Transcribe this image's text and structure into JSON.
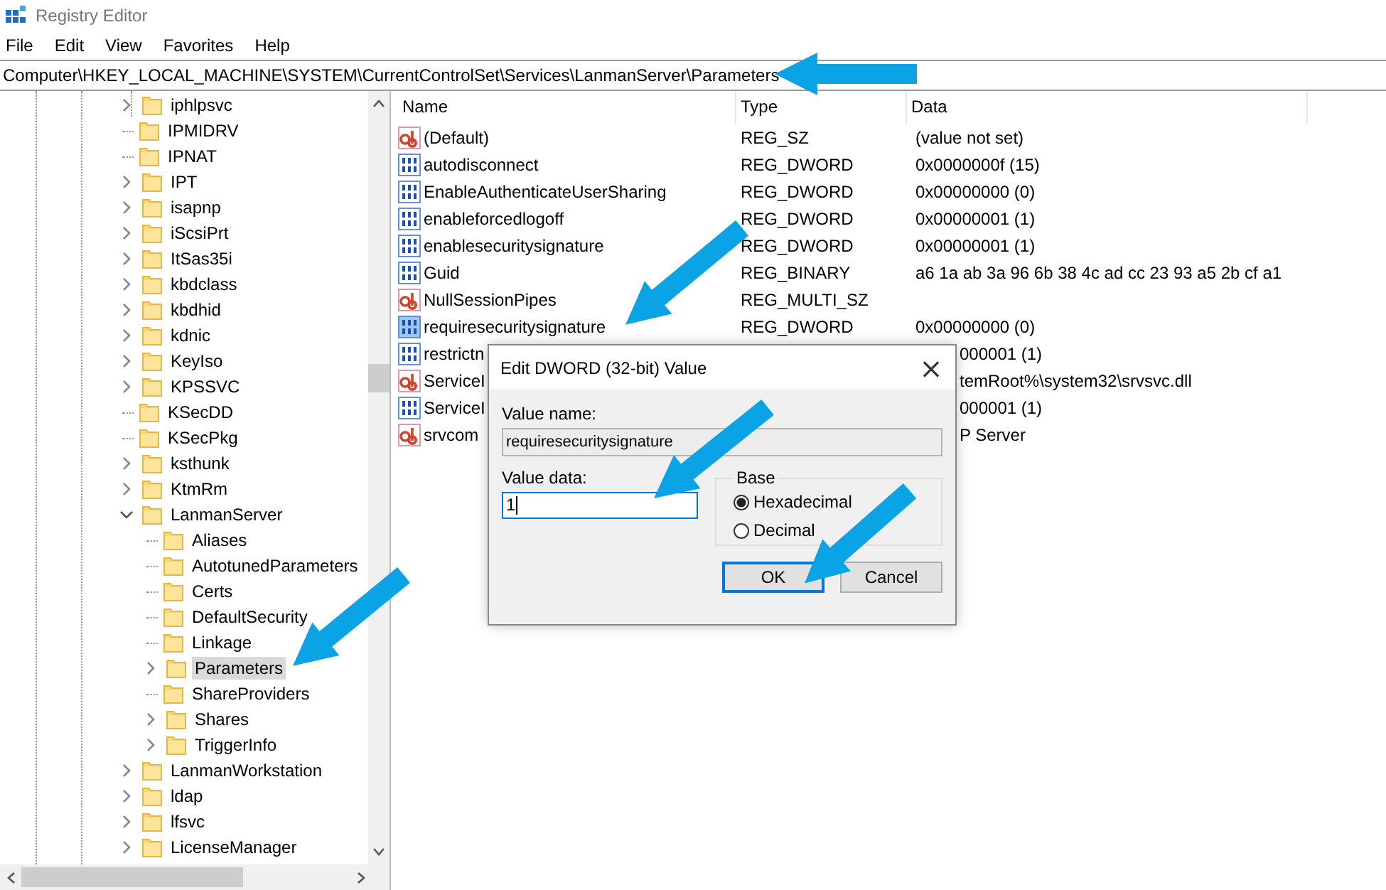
{
  "window": {
    "title": "Registry Editor"
  },
  "menu": [
    "File",
    "Edit",
    "View",
    "Favorites",
    "Help"
  ],
  "address_bar": {
    "value": "Computer\\HKEY_LOCAL_MACHINE\\SYSTEM\\CurrentControlSet\\Services\\LanmanServer\\Parameters"
  },
  "tree": {
    "items": [
      {
        "label": "iphlpsvc",
        "has_children": true,
        "expanded": false,
        "selected": false
      },
      {
        "label": "IPMIDRV",
        "has_children": false,
        "expanded": false,
        "selected": false
      },
      {
        "label": "IPNAT",
        "has_children": false,
        "expanded": false,
        "selected": false
      },
      {
        "label": "IPT",
        "has_children": true,
        "expanded": false,
        "selected": false
      },
      {
        "label": "isapnp",
        "has_children": true,
        "expanded": false,
        "selected": false
      },
      {
        "label": "iScsiPrt",
        "has_children": true,
        "expanded": false,
        "selected": false
      },
      {
        "label": "ItSas35i",
        "has_children": true,
        "expanded": false,
        "selected": false
      },
      {
        "label": "kbdclass",
        "has_children": true,
        "expanded": false,
        "selected": false
      },
      {
        "label": "kbdhid",
        "has_children": true,
        "expanded": false,
        "selected": false
      },
      {
        "label": "kdnic",
        "has_children": true,
        "expanded": false,
        "selected": false
      },
      {
        "label": "KeyIso",
        "has_children": true,
        "expanded": false,
        "selected": false
      },
      {
        "label": "KPSSVC",
        "has_children": true,
        "expanded": false,
        "selected": false
      },
      {
        "label": "KSecDD",
        "has_children": false,
        "expanded": false,
        "selected": false
      },
      {
        "label": "KSecPkg",
        "has_children": false,
        "expanded": false,
        "selected": false
      },
      {
        "label": "ksthunk",
        "has_children": true,
        "expanded": false,
        "selected": false
      },
      {
        "label": "KtmRm",
        "has_children": true,
        "expanded": false,
        "selected": false
      },
      {
        "label": "LanmanServer",
        "has_children": true,
        "expanded": true,
        "selected": false,
        "children": [
          {
            "label": "Aliases",
            "has_children": false,
            "expanded": false,
            "selected": false
          },
          {
            "label": "AutotunedParameters",
            "has_children": false,
            "expanded": false,
            "selected": false
          },
          {
            "label": "Certs",
            "has_children": false,
            "expanded": false,
            "selected": false
          },
          {
            "label": "DefaultSecurity",
            "has_children": false,
            "expanded": false,
            "selected": false
          },
          {
            "label": "Linkage",
            "has_children": false,
            "expanded": false,
            "selected": false
          },
          {
            "label": "Parameters",
            "has_children": true,
            "expanded": false,
            "selected": true
          },
          {
            "label": "ShareProviders",
            "has_children": false,
            "expanded": false,
            "selected": false
          },
          {
            "label": "Shares",
            "has_children": true,
            "expanded": false,
            "selected": false
          },
          {
            "label": "TriggerInfo",
            "has_children": true,
            "expanded": false,
            "selected": false
          }
        ]
      },
      {
        "label": "LanmanWorkstation",
        "has_children": true,
        "expanded": false,
        "selected": false
      },
      {
        "label": "ldap",
        "has_children": true,
        "expanded": false,
        "selected": false
      },
      {
        "label": "lfsvc",
        "has_children": true,
        "expanded": false,
        "selected": false
      },
      {
        "label": "LicenseManager",
        "has_children": true,
        "expanded": false,
        "selected": false
      }
    ]
  },
  "values": {
    "columns": [
      "Name",
      "Type",
      "Data"
    ],
    "rows": [
      {
        "kind": "string",
        "name": "(Default)",
        "type": "REG_SZ",
        "data": "(value not set)",
        "selected": false
      },
      {
        "kind": "binary",
        "name": "autodisconnect",
        "type": "REG_DWORD",
        "data": "0x0000000f (15)",
        "selected": false
      },
      {
        "kind": "binary",
        "name": "EnableAuthenticateUserSharing",
        "type": "REG_DWORD",
        "data": "0x00000000 (0)",
        "selected": false
      },
      {
        "kind": "binary",
        "name": "enableforcedlogoff",
        "type": "REG_DWORD",
        "data": "0x00000001 (1)",
        "selected": false
      },
      {
        "kind": "binary",
        "name": "enablesecuritysignature",
        "type": "REG_DWORD",
        "data": "0x00000001 (1)",
        "selected": false
      },
      {
        "kind": "binary",
        "name": "Guid",
        "type": "REG_BINARY",
        "data": "a6 1a ab 3a 96 6b 38 4c ad cc 23 93 a5 2b cf a1",
        "selected": false
      },
      {
        "kind": "string",
        "name": "NullSessionPipes",
        "type": "REG_MULTI_SZ",
        "selected": false
      },
      {
        "kind": "binary",
        "name": "requiresecuritysignature",
        "type": "REG_DWORD",
        "data": "0x00000000 (0)",
        "selected": true
      },
      {
        "kind": "binary",
        "name": "restrictn",
        "data": "000001 (1)",
        "selected": false
      },
      {
        "kind": "string",
        "name": "ServiceI",
        "data": "temRoot%\\system32\\srvsvc.dll",
        "selected": false
      },
      {
        "kind": "binary",
        "name": "ServiceI",
        "data": "000001 (1)",
        "selected": false
      },
      {
        "kind": "string",
        "name": "srvcom",
        "data": "P Server",
        "selected": false
      }
    ]
  },
  "dialog": {
    "title": "Edit DWORD (32-bit) Value",
    "close": "×",
    "value_name_label": "Value name:",
    "value_name": "requiresecuritysignature",
    "value_data_label": "Value data:",
    "value_data": "1",
    "base_label": "Base",
    "base_options": [
      {
        "label": "Hexadecimal",
        "selected": true
      },
      {
        "label": "Decimal",
        "selected": false
      }
    ],
    "buttons": [
      {
        "label": "OK",
        "default": true
      },
      {
        "label": "Cancel",
        "default": false
      }
    ]
  }
}
